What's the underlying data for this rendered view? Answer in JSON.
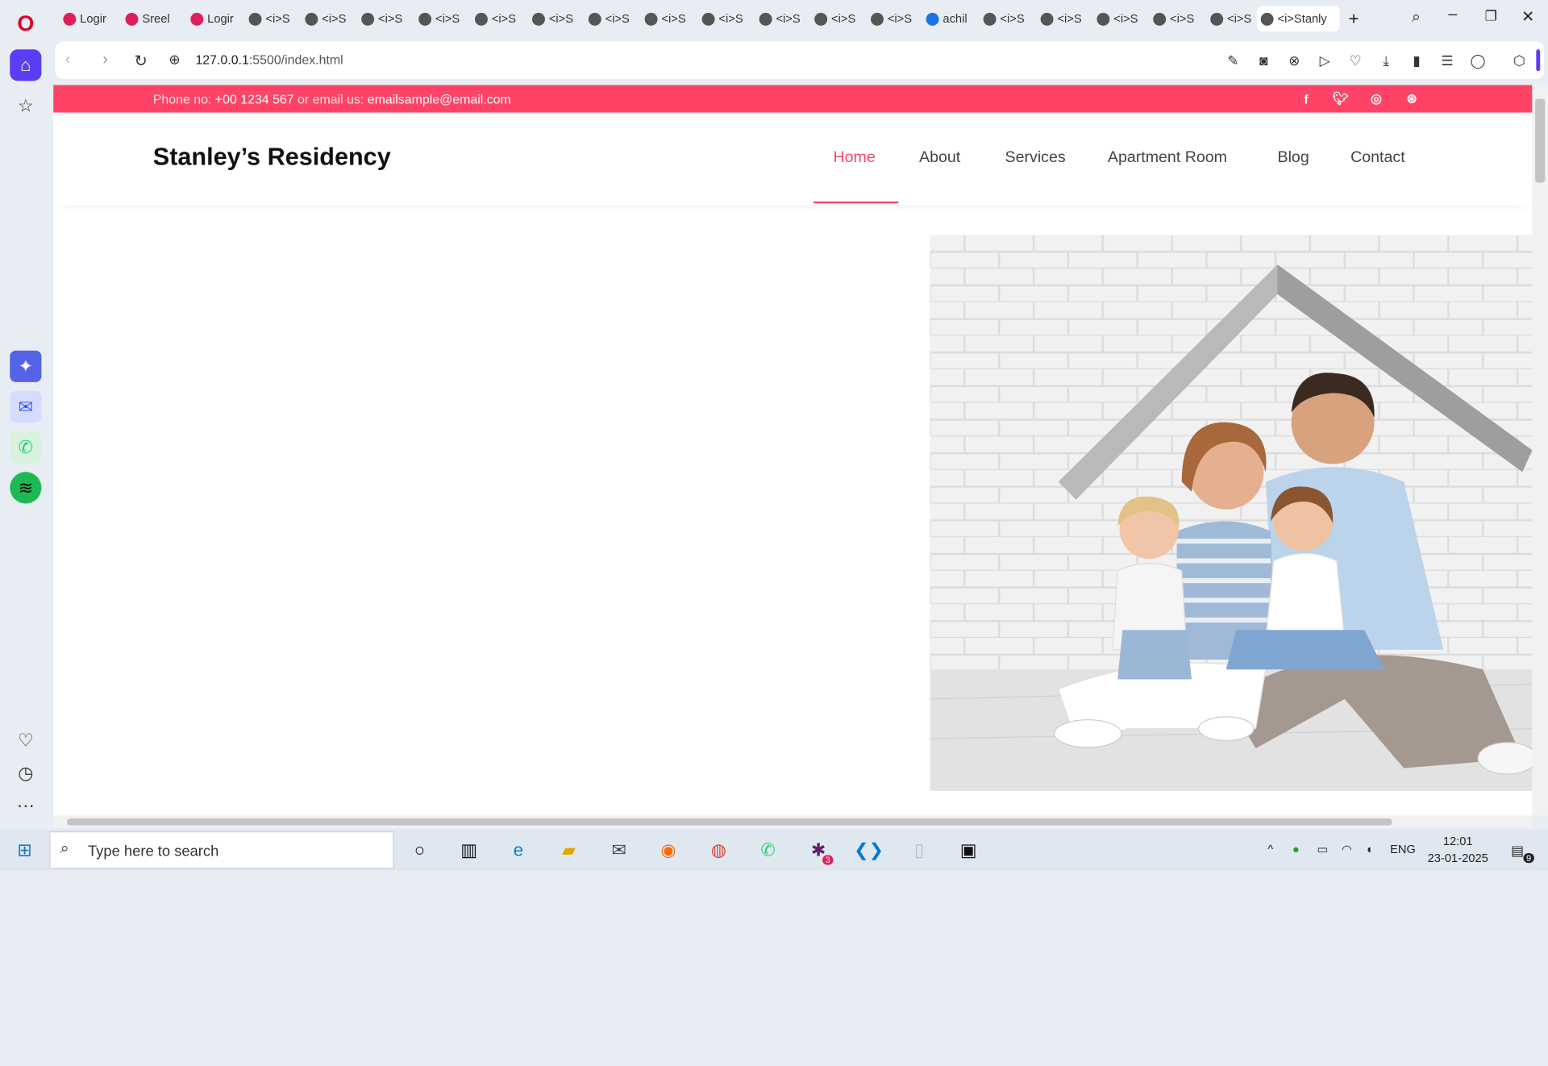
{
  "browser": {
    "tabs": [
      {
        "label": "Logir",
        "icon": "slack-icon"
      },
      {
        "label": "Sreel",
        "icon": "slack-icon"
      },
      {
        "label": "Logir",
        "icon": "slack-icon"
      },
      {
        "label": "<i>S",
        "icon": "globe-icon"
      },
      {
        "label": "<i>S",
        "icon": "globe-icon"
      },
      {
        "label": "<i>S",
        "icon": "globe-icon"
      },
      {
        "label": "<i>S",
        "icon": "globe-icon"
      },
      {
        "label": "<i>S",
        "icon": "globe-icon"
      },
      {
        "label": "<i>S",
        "icon": "globe-icon"
      },
      {
        "label": "<i>S",
        "icon": "globe-icon"
      },
      {
        "label": "<i>S",
        "icon": "globe-icon"
      },
      {
        "label": "<i>S",
        "icon": "globe-icon"
      },
      {
        "label": "<i>S",
        "icon": "globe-icon"
      },
      {
        "label": "<i>S",
        "icon": "globe-icon"
      },
      {
        "label": "<i>S",
        "icon": "globe-icon"
      },
      {
        "label": "achil",
        "icon": "search-icon"
      },
      {
        "label": "<i>S",
        "icon": "globe-icon"
      },
      {
        "label": "<i>S",
        "icon": "globe-icon"
      },
      {
        "label": "<i>S",
        "icon": "globe-icon"
      },
      {
        "label": "<i>S",
        "icon": "globe-icon"
      },
      {
        "label": "<i>S",
        "icon": "globe-icon"
      },
      {
        "label": "<i>Stanly",
        "icon": "globe-icon",
        "active": true
      }
    ],
    "url_host": "127.0.0.1",
    "url_path": ":5500/index.html"
  },
  "site": {
    "topbar": {
      "phone_label": "Phone no: ",
      "phone": "+00 1234 567",
      "or_label": " or email us: ",
      "email": "emailsample@email.com"
    },
    "brand": "Stanley’s Residency",
    "menu": [
      "Home",
      "About",
      "Services",
      "Apartment Room",
      "Blog",
      "Contact"
    ],
    "active_menu": "Home",
    "hero_image_alt": "family under paper roof"
  },
  "taskbar": {
    "search_placeholder": "Type here to search",
    "lang": "ENG",
    "time": "12:01",
    "date": "23-01-2025",
    "notifications": "9",
    "slack_badge": "3"
  },
  "colors": {
    "accent": "#ff4366",
    "browser_bg": "#e8edf3"
  }
}
